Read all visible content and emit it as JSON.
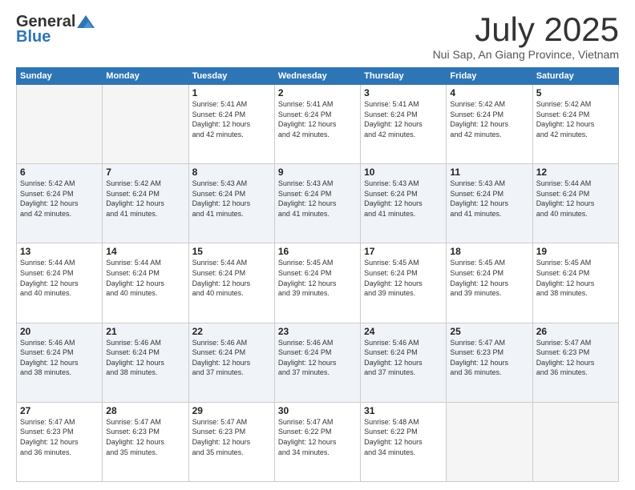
{
  "header": {
    "logo_line1": "General",
    "logo_line2": "Blue",
    "month_title": "July 2025",
    "subtitle": "Nui Sap, An Giang Province, Vietnam"
  },
  "weekdays": [
    "Sunday",
    "Monday",
    "Tuesday",
    "Wednesday",
    "Thursday",
    "Friday",
    "Saturday"
  ],
  "weeks": [
    [
      {
        "day": "",
        "detail": "",
        "empty": true
      },
      {
        "day": "",
        "detail": "",
        "empty": true
      },
      {
        "day": "1",
        "detail": "Sunrise: 5:41 AM\nSunset: 6:24 PM\nDaylight: 12 hours\nand 42 minutes."
      },
      {
        "day": "2",
        "detail": "Sunrise: 5:41 AM\nSunset: 6:24 PM\nDaylight: 12 hours\nand 42 minutes."
      },
      {
        "day": "3",
        "detail": "Sunrise: 5:41 AM\nSunset: 6:24 PM\nDaylight: 12 hours\nand 42 minutes."
      },
      {
        "day": "4",
        "detail": "Sunrise: 5:42 AM\nSunset: 6:24 PM\nDaylight: 12 hours\nand 42 minutes."
      },
      {
        "day": "5",
        "detail": "Sunrise: 5:42 AM\nSunset: 6:24 PM\nDaylight: 12 hours\nand 42 minutes."
      }
    ],
    [
      {
        "day": "6",
        "detail": "Sunrise: 5:42 AM\nSunset: 6:24 PM\nDaylight: 12 hours\nand 42 minutes."
      },
      {
        "day": "7",
        "detail": "Sunrise: 5:42 AM\nSunset: 6:24 PM\nDaylight: 12 hours\nand 41 minutes."
      },
      {
        "day": "8",
        "detail": "Sunrise: 5:43 AM\nSunset: 6:24 PM\nDaylight: 12 hours\nand 41 minutes."
      },
      {
        "day": "9",
        "detail": "Sunrise: 5:43 AM\nSunset: 6:24 PM\nDaylight: 12 hours\nand 41 minutes."
      },
      {
        "day": "10",
        "detail": "Sunrise: 5:43 AM\nSunset: 6:24 PM\nDaylight: 12 hours\nand 41 minutes."
      },
      {
        "day": "11",
        "detail": "Sunrise: 5:43 AM\nSunset: 6:24 PM\nDaylight: 12 hours\nand 41 minutes."
      },
      {
        "day": "12",
        "detail": "Sunrise: 5:44 AM\nSunset: 6:24 PM\nDaylight: 12 hours\nand 40 minutes."
      }
    ],
    [
      {
        "day": "13",
        "detail": "Sunrise: 5:44 AM\nSunset: 6:24 PM\nDaylight: 12 hours\nand 40 minutes."
      },
      {
        "day": "14",
        "detail": "Sunrise: 5:44 AM\nSunset: 6:24 PM\nDaylight: 12 hours\nand 40 minutes."
      },
      {
        "day": "15",
        "detail": "Sunrise: 5:44 AM\nSunset: 6:24 PM\nDaylight: 12 hours\nand 40 minutes."
      },
      {
        "day": "16",
        "detail": "Sunrise: 5:45 AM\nSunset: 6:24 PM\nDaylight: 12 hours\nand 39 minutes."
      },
      {
        "day": "17",
        "detail": "Sunrise: 5:45 AM\nSunset: 6:24 PM\nDaylight: 12 hours\nand 39 minutes."
      },
      {
        "day": "18",
        "detail": "Sunrise: 5:45 AM\nSunset: 6:24 PM\nDaylight: 12 hours\nand 39 minutes."
      },
      {
        "day": "19",
        "detail": "Sunrise: 5:45 AM\nSunset: 6:24 PM\nDaylight: 12 hours\nand 38 minutes."
      }
    ],
    [
      {
        "day": "20",
        "detail": "Sunrise: 5:46 AM\nSunset: 6:24 PM\nDaylight: 12 hours\nand 38 minutes."
      },
      {
        "day": "21",
        "detail": "Sunrise: 5:46 AM\nSunset: 6:24 PM\nDaylight: 12 hours\nand 38 minutes."
      },
      {
        "day": "22",
        "detail": "Sunrise: 5:46 AM\nSunset: 6:24 PM\nDaylight: 12 hours\nand 37 minutes."
      },
      {
        "day": "23",
        "detail": "Sunrise: 5:46 AM\nSunset: 6:24 PM\nDaylight: 12 hours\nand 37 minutes."
      },
      {
        "day": "24",
        "detail": "Sunrise: 5:46 AM\nSunset: 6:24 PM\nDaylight: 12 hours\nand 37 minutes."
      },
      {
        "day": "25",
        "detail": "Sunrise: 5:47 AM\nSunset: 6:23 PM\nDaylight: 12 hours\nand 36 minutes."
      },
      {
        "day": "26",
        "detail": "Sunrise: 5:47 AM\nSunset: 6:23 PM\nDaylight: 12 hours\nand 36 minutes."
      }
    ],
    [
      {
        "day": "27",
        "detail": "Sunrise: 5:47 AM\nSunset: 6:23 PM\nDaylight: 12 hours\nand 36 minutes."
      },
      {
        "day": "28",
        "detail": "Sunrise: 5:47 AM\nSunset: 6:23 PM\nDaylight: 12 hours\nand 35 minutes."
      },
      {
        "day": "29",
        "detail": "Sunrise: 5:47 AM\nSunset: 6:23 PM\nDaylight: 12 hours\nand 35 minutes."
      },
      {
        "day": "30",
        "detail": "Sunrise: 5:47 AM\nSunset: 6:22 PM\nDaylight: 12 hours\nand 34 minutes."
      },
      {
        "day": "31",
        "detail": "Sunrise: 5:48 AM\nSunset: 6:22 PM\nDaylight: 12 hours\nand 34 minutes."
      },
      {
        "day": "",
        "detail": "",
        "empty": true
      },
      {
        "day": "",
        "detail": "",
        "empty": true
      }
    ]
  ]
}
